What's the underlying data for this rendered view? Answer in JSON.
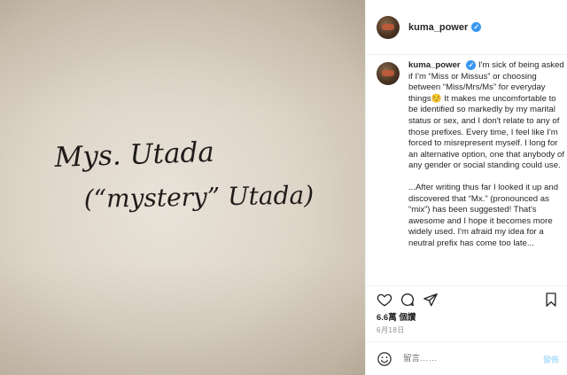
{
  "photo": {
    "line1": "Mys. Utada",
    "line2": "(“mystery” Utada)"
  },
  "header": {
    "username": "kuma_power",
    "verified_icon": "verified-badge-icon"
  },
  "caption": {
    "username": "kuma_power",
    "paragraph1": "I'm sick of being asked if I'm “Miss or Missus” or choosing between “Miss/Mrs/Ms” for everyday things☺️ It makes me uncomfortable to be identified so markedly by my marital status or sex, and I don't relate to any of those prefixes. Every time, I feel like I'm forced to misrepresent myself. I long for an alternative option, one that anybody of any gender or social standing could use.",
    "paragraph2": "...After writing thus far I looked it up and discovered that “Mx.” (pronounced as “mix”) has been suggested! That's awesome and I hope it becomes more widely used. I'm afraid my idea for a neutral prefix has come too late..."
  },
  "actions": {
    "like_icon": "heart-icon",
    "comment_icon": "comment-icon",
    "share_icon": "send-icon",
    "save_icon": "bookmark-icon"
  },
  "likes_text": "6.6萬 個讚",
  "date_text": "6月18日",
  "comment_bar": {
    "emoji_icon": "smiley-icon",
    "placeholder": "留言……",
    "post_label": "發佈"
  },
  "colors": {
    "accent": "#3897f0",
    "post_disabled": "#b2dffc",
    "ink": "#1f1b1a"
  }
}
